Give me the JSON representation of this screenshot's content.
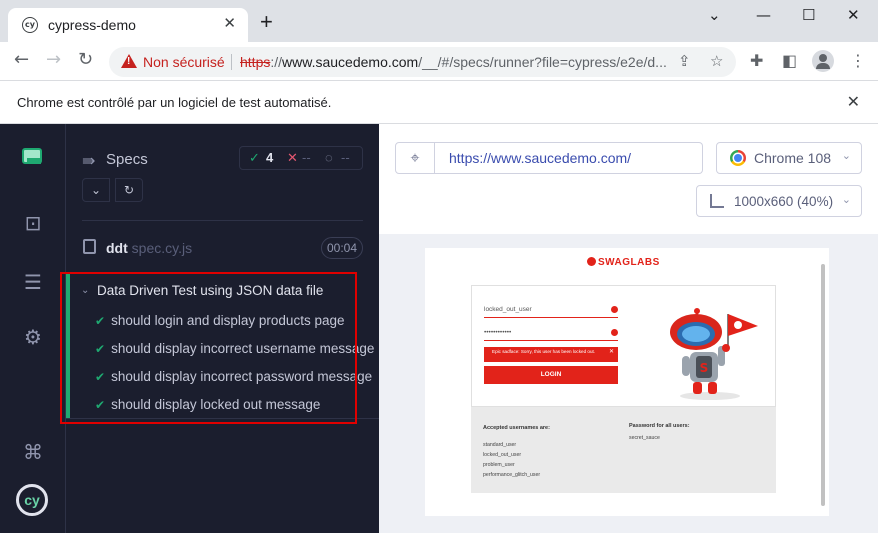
{
  "browser": {
    "tab_title": "cypress-demo",
    "tab_favicon": "cy",
    "insecure_label": "Non sécurisé",
    "url_scheme": "https",
    "url_sep": "://",
    "url_host": "www.saucedemo.com",
    "url_path": "/__/#/specs/runner?file=cypress/e2e/d...",
    "infobar_text": "Chrome est contrôlé par un logiciel de test automatisé.",
    "icons": {
      "back": "arrow-left-icon",
      "forward": "arrow-right-icon",
      "reload": "reload-icon",
      "share": "share-icon",
      "bookmark": "star-icon",
      "extensions": "puzzle-icon",
      "sidepanel": "side-panel-icon",
      "profile": "profile-icon",
      "menu": "kebab-menu-icon"
    }
  },
  "cypress": {
    "nav_icons": [
      "app-logo-icon",
      "runner-icon",
      "list-icon",
      "gear-icon",
      "command-icon",
      "cypress-logo-icon"
    ],
    "logo_text": "cy",
    "reporter": {
      "title": "Specs",
      "passed": "4",
      "failed": "--",
      "pending": "--",
      "spec_name": "ddt",
      "spec_ext": " spec.cy.js",
      "duration": "00:04",
      "suite_title": "Data Driven Test using JSON data file",
      "tests": [
        {
          "title": "should login and display products page",
          "state": "passed"
        },
        {
          "title": "should display incorrect username message",
          "state": "passed"
        },
        {
          "title": "should display incorrect password message",
          "state": "passed"
        },
        {
          "title": "should display locked out message",
          "state": "passed"
        }
      ]
    },
    "aut": {
      "url": "https://www.saucedemo.com/",
      "browser": "Chrome 108",
      "viewport": "1000x660 (40%)"
    }
  },
  "saucedemo": {
    "logo": "SWAGLABS",
    "username_value": "locked_out_user",
    "password_value": "••••••••••••",
    "error_text": "Epic sadface: Sorry, this user has been locked out.",
    "login_label": "LOGIN",
    "accepted_heading": "Accepted usernames are:",
    "usernames": [
      "standard_user",
      "locked_out_user",
      "problem_user",
      "performance_glitch_user"
    ],
    "password_heading": "Password for all users:",
    "password": "secret_sauce"
  },
  "colors": {
    "cypress_bg": "#1b1e2e",
    "pass_green": "#1fa971",
    "highlight_red": "#e00000",
    "sauce_red": "#e2231a",
    "insecure_red": "#c5221f"
  }
}
